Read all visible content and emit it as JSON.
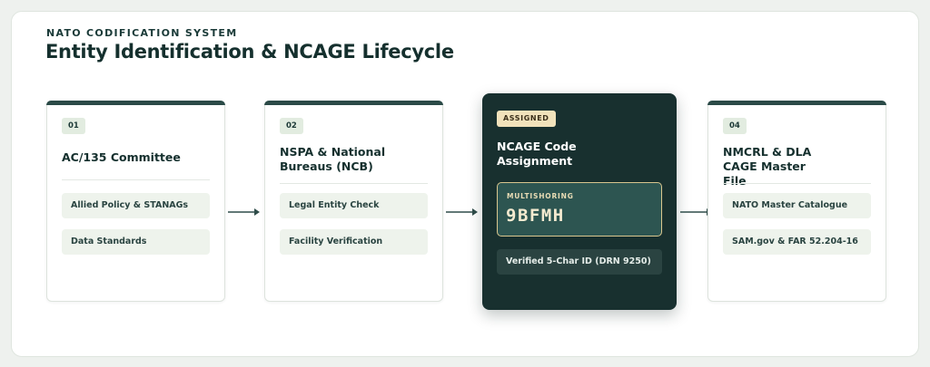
{
  "header": {
    "eyebrow": "NATO CODIFICATION SYSTEM",
    "title": "Entity Identification & NCAGE Lifecycle"
  },
  "stages": [
    {
      "number": "01",
      "title": "AC/135 Committee",
      "items": [
        "Allied Policy & STANAGs",
        "Data Standards"
      ]
    },
    {
      "number": "02",
      "title": "NSPA & National Bureaus (NCB)",
      "items": [
        "Legal Entity Check",
        "Facility Verification"
      ]
    },
    {
      "status": "ASSIGNED",
      "title": "NCAGE Code Assignment",
      "code_label": "MULTISHORING",
      "code_value": "9BFMH",
      "items": [
        "Verified 5-Char ID (DRN 9250)"
      ]
    },
    {
      "number": "04",
      "title": "NMCRL & DLA CAGE Master File",
      "items": [
        "NATO Master Catalogue",
        "SAM.gov & FAR 52.204-16"
      ]
    }
  ],
  "colors": {
    "accent_dark": "#18302f",
    "topbar": "#2b4a47",
    "gold": "#d9c68e",
    "arrow": "#2f4d4a"
  },
  "icons": [
    "arrow-right-icon"
  ]
}
